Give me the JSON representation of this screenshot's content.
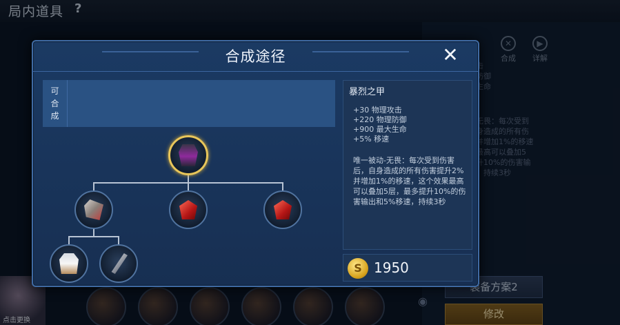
{
  "background": {
    "title": "局内道具",
    "help_icon": "?",
    "tools": [
      {
        "label": "合成",
        "icon": "compose-icon"
      },
      {
        "label": "详解",
        "icon": "detail-icon"
      }
    ],
    "desc_lines": [
      "击",
      "防御",
      "生命",
      "",
      "无畏：每次受到",
      "身造成的所有伤",
      "并增加1%的移速",
      "最高可以叠加5",
      "升10%的伤害输",
      "，持续3秒"
    ],
    "scheme_button": "装备方案2",
    "modify_button": "修改",
    "avatar_label": "点击更换"
  },
  "modal": {
    "title": "合成途径",
    "close_icon": "close-icon",
    "compose_label": [
      "可",
      "合",
      "成"
    ],
    "tree": {
      "root": {
        "name": "暴烈之甲",
        "icon": "armor-icon"
      },
      "children": [
        {
          "icon": "gauntlet-icon",
          "children": [
            {
              "icon": "vest-icon"
            },
            {
              "icon": "spear-icon"
            }
          ]
        },
        {
          "icon": "red-gem-icon"
        },
        {
          "icon": "red-gem-icon"
        }
      ]
    },
    "item": {
      "name": "暴烈之甲",
      "stats": [
        "+30 物理攻击",
        "+220 物理防御",
        "+900 最大生命",
        "+5% 移速"
      ],
      "passive": "唯一被动-无畏：每次受到伤害后，自身造成的所有伤害提升2%并增加1%的移速，这个效果最高可以叠加5层，最多提升10%的伤害输出和5%移速，持续3秒",
      "price": "1950"
    }
  }
}
